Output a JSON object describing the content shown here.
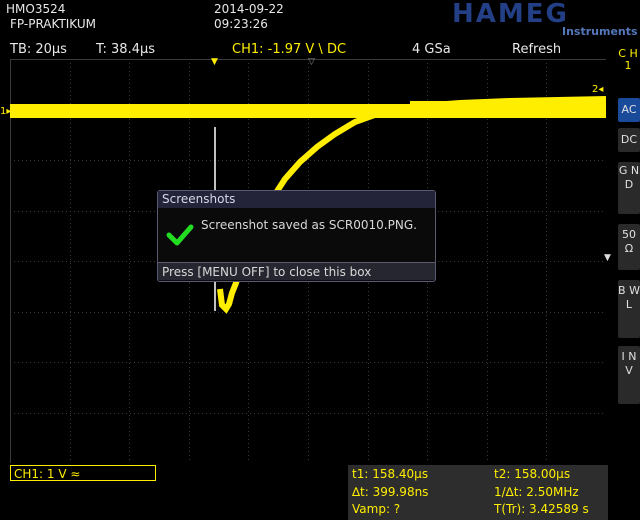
{
  "header": {
    "model": "HMO3524",
    "label": "FP-PRAKTIKUM",
    "date": "2014-09-22",
    "time": "09:23:26",
    "logo": "HAMEG",
    "logo_sub": "Instruments"
  },
  "status": {
    "timebase": "TB: 20µs",
    "trigger_time": "T: 38.4µs",
    "ch1_trigger": "CH1: -1.97 V \\ DC",
    "sample_rate": "4 GSa",
    "mode": "Refresh"
  },
  "sidebar": {
    "channel": "C H 1",
    "buttons": [
      "AC",
      "DC",
      "G N D",
      "50 Ω",
      "B W L",
      "I N V"
    ],
    "active": "AC"
  },
  "markers": {
    "ch1_level": "1",
    "trig_level": "2"
  },
  "dialog": {
    "title": "Screenshots",
    "message": "Screenshot saved as SCR0010.PNG.",
    "footer": "Press [MENU OFF] to close this box",
    "icon": "checkmark-icon"
  },
  "channel_box": {
    "label": "CH1: 1 V ≈"
  },
  "measurements": {
    "t1": "t1: 158.40µs",
    "t2": "t2: 158.00µs",
    "dt": "∆t: 399.98ns",
    "inv_dt": "1/∆t: 2.50MHz",
    "vamp": "Vamp: ?",
    "ttr": "T(Tr): 3.42589 s"
  },
  "colors": {
    "trace": "#ffee00",
    "accent": "#1a4a9a",
    "brand": "#233f86"
  }
}
